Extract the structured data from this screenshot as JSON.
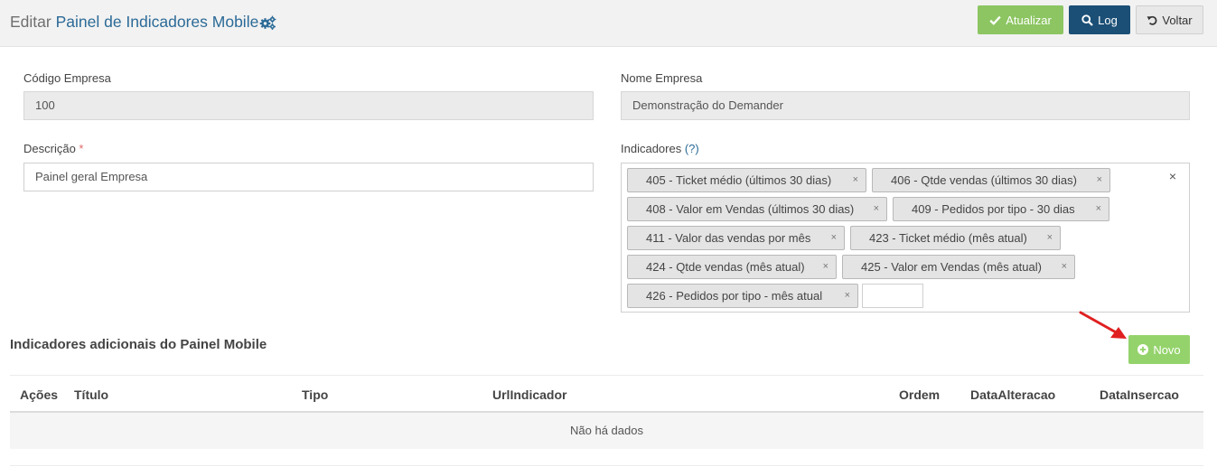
{
  "header": {
    "title_verb": "Editar",
    "title_entity": "Painel de Indicadores Mobile",
    "update_label": "Atualizar",
    "log_label": "Log",
    "back_label": "Voltar"
  },
  "form": {
    "codigo_label": "Código Empresa",
    "codigo_value": "100",
    "nome_label": "Nome Empresa",
    "nome_value": "Demonstração do Demander",
    "descricao_label": "Descrição",
    "required_mark": "*",
    "descricao_value": "Painel geral Empresa",
    "indicadores_label": "Indicadores",
    "indicadores_help": "(?)",
    "clear_symbol": "×",
    "tag_remove_symbol": "×",
    "tags": [
      "405 - Ticket médio (últimos 30 dias)",
      "406 - Qtde vendas (últimos 30 dias)",
      "408 - Valor em Vendas (últimos 30 dias)",
      "409 - Pedidos por tipo - 30 dias",
      "411 - Valor das vendas por mês",
      "423 - Ticket médio (mês atual)",
      "424 - Qtde vendas (mês atual)",
      "425 - Valor em Vendas (mês atual)",
      "426 - Pedidos por tipo - mês atual"
    ]
  },
  "section": {
    "title": "Indicadores adicionais do Painel Mobile",
    "new_label": "Novo"
  },
  "table": {
    "columns": [
      "Ações",
      "Título",
      "Tipo",
      "UrlIndicador",
      "Ordem",
      "DataAlteracao",
      "DataInsercao"
    ],
    "empty_text": "Não há dados"
  },
  "colors": {
    "update": "#8cc561",
    "log": "#1b4f76",
    "new": "#94d36b",
    "title_accent": "#2b6a97",
    "arrow": "#e02020"
  },
  "icons": {
    "title": "gears-icon",
    "update": "check-icon",
    "back": "undo-icon",
    "new": "plus-circle-icon",
    "annotation": "red-arrow-icon"
  }
}
